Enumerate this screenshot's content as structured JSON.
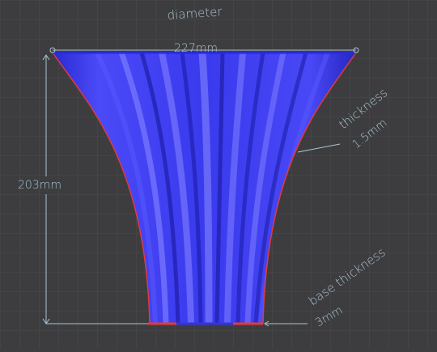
{
  "annotations": {
    "diameter_label": "diameter",
    "diameter_value": "227mm",
    "height_value": "203mm",
    "thickness_label": "thickness",
    "thickness_value": "1.5mm",
    "base_thickness_label": "base thickness",
    "base_thickness_value": "3mm"
  },
  "colors": {
    "background": "#3d3d3f",
    "grid": "#4a4a4c",
    "vase_body": "#3a3af2",
    "vase_highlight": "#7a7aff",
    "vase_shadow": "#1e1ea8",
    "edge": "#e23a3a",
    "dimension_lines": "#a9c4d2"
  }
}
